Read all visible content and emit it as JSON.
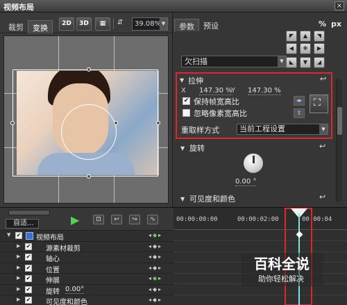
{
  "window": {
    "title": "视频布局",
    "close_label": "×"
  },
  "left_panel": {
    "tabs": [
      "裁剪",
      "变换"
    ],
    "toolbar": {
      "btn_2d": "2D",
      "btn_3d": "3D",
      "zoom": "39.08%"
    }
  },
  "right_panel": {
    "tabs": [
      "参数",
      "预设"
    ],
    "units": {
      "percent": "%",
      "px": "px"
    },
    "scan_mode": "欠扫描",
    "stretch": {
      "title": "拉伸",
      "x_label": "X",
      "x_value": "147.30 %",
      "y_label": "Y",
      "y_value": "147.30 %",
      "keep_aspect": {
        "label": "保持帧宽高比",
        "checked": true
      },
      "ignore_pixel_aspect": {
        "label": "忽略像素宽高比",
        "checked": false
      },
      "resample_label": "重取样方式",
      "resample_value": "当前工程设置"
    },
    "rotate": {
      "title": "旋转",
      "value": "0.00 °"
    },
    "visibility": {
      "title": "可见度和颜色"
    }
  },
  "timeline": {
    "preset": "自适...",
    "ruler": [
      "00:00:00:00",
      "00:00:02:00",
      "00:00:04"
    ],
    "tracks": [
      {
        "name": "视频布局",
        "checked": true
      },
      {
        "name": "源素材裁剪",
        "checked": true
      },
      {
        "name": "轴心",
        "checked": true
      },
      {
        "name": "位置",
        "checked": true
      },
      {
        "name": "伸展",
        "checked": true
      },
      {
        "name": "旋转",
        "checked": true,
        "value": "0.00°"
      },
      {
        "name": "可见度和颜色",
        "checked": true
      }
    ]
  },
  "watermark": {
    "logo": "百科全说",
    "sub": "助你轻松解决"
  }
}
